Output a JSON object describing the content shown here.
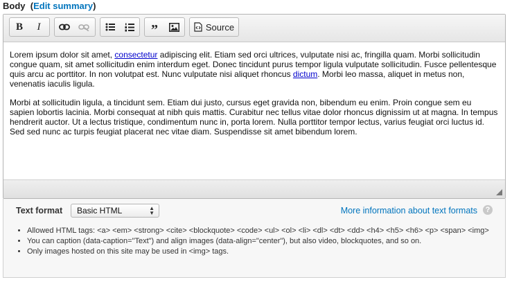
{
  "field": {
    "label": "Body",
    "edit_link": "Edit summary",
    "open_paren": "(",
    "close_paren": ")"
  },
  "toolbar": {
    "bold": "B",
    "italic": "I",
    "link_icon": "link-icon",
    "unlink_icon": "unlink-icon",
    "bullet_list_icon": "bulleted-list-icon",
    "numbered_list_icon": "numbered-list-icon",
    "blockquote": "”",
    "image_icon": "image-icon",
    "source_label": "Source"
  },
  "content": {
    "p1": {
      "a": "Lorem ipsum dolor sit amet, ",
      "link1": "consectetur",
      "b": " adipiscing elit. Etiam sed orci ultrices, vulputate nisi ac, fringilla quam. Morbi sollicitudin congue quam, sit amet sollicitudin enim interdum eget. Donec tincidunt purus tempor ligula vulputate sollicitudin. Fusce pellentesque quis arcu ac porttitor. In non volutpat est. Nunc vulputate nisi aliquet rhoncus ",
      "link2": "dictum",
      "c": ". Morbi leo massa, aliquet in metus non, venenatis iaculis ligula."
    },
    "p2": "Morbi at sollicitudin ligula, a tincidunt sem. Etiam dui justo, cursus eget gravida non, bibendum eu enim. Proin congue sem eu sapien lobortis lacinia. Morbi consequat at nibh quis mattis. Curabitur nec tellus vitae dolor rhoncus dignissim ut at magna. In tempus hendrerit auctor. Ut a lectus tristique, condimentum nunc in, porta lorem. Nulla porttitor tempor lectus, varius feugiat orci luctus id. Sed sed nunc ac turpis feugiat placerat nec vitae diam. Suspendisse sit amet bibendum lorem."
  },
  "format": {
    "label": "Text format",
    "selected": "Basic HTML",
    "more_link": "More information about text formats",
    "help": "?",
    "tips": [
      "Allowed HTML tags: <a> <em> <strong> <cite> <blockquote> <code> <ul> <ol> <li> <dl> <dt> <dd> <h4> <h5> <h6> <p> <span> <img>",
      "You can caption (data-caption=\"Text\") and align images (data-align=\"center\"), but also video, blockquotes, and so on.",
      "Only images hosted on this site may be used in <img> tags."
    ]
  },
  "colors": {
    "link": "#0074bd",
    "toolbar": "#ececec",
    "format_bg": "#f7f7f7"
  }
}
